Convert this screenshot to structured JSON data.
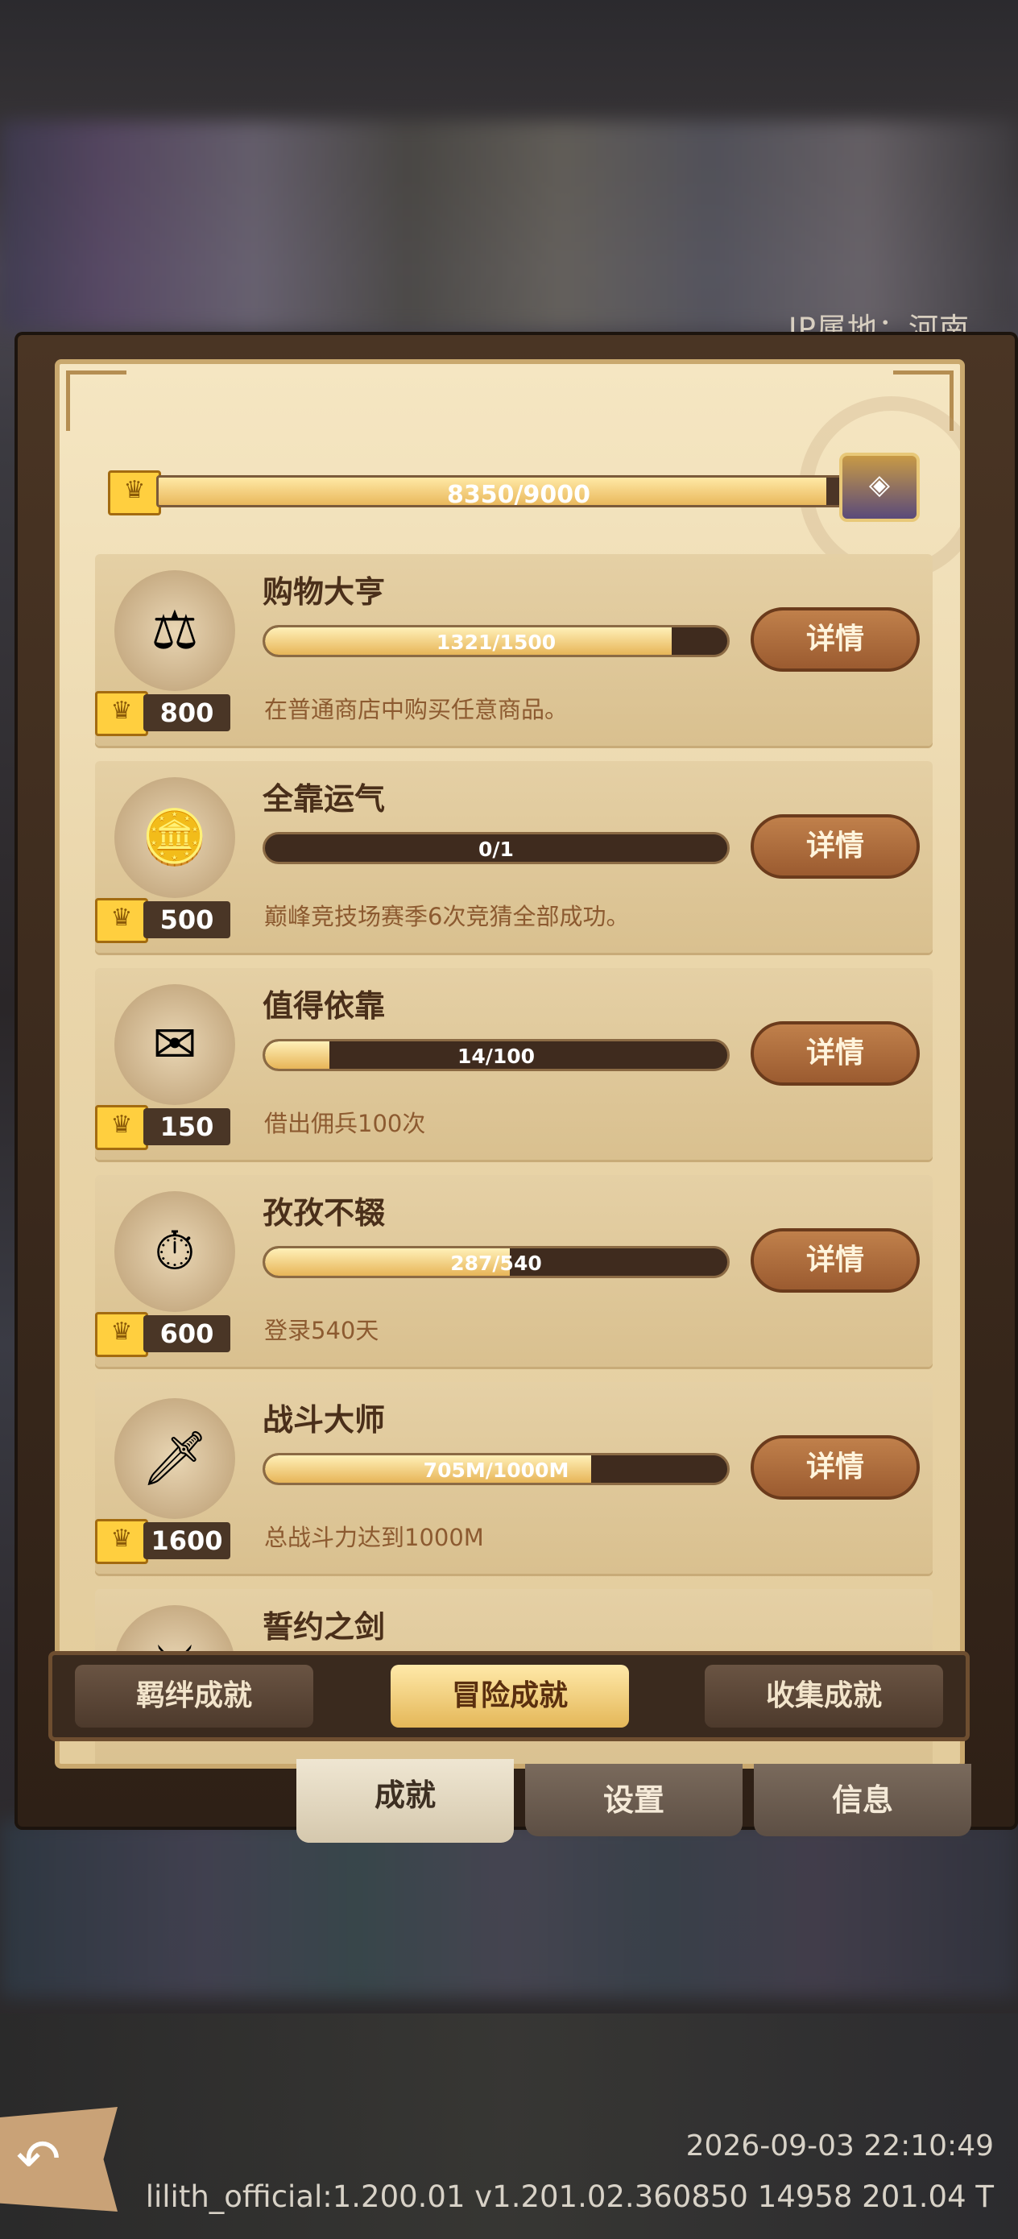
{
  "ip_location": "IP属地：河南",
  "total": {
    "current": 8350,
    "max": 9000,
    "text": "8350/9000",
    "crown_icon": "♛",
    "chest_icon": "◈"
  },
  "achievements": [
    {
      "title": "购物大亨",
      "progress_text": "1321/1500",
      "progress": 0.88,
      "points": "800",
      "description": "在普通商店中购买任意商品。",
      "button": "详情",
      "icon": "⚖"
    },
    {
      "title": "全靠运气",
      "progress_text": "0/1",
      "progress": 0.0,
      "points": "500",
      "description": "巅峰竞技场赛季6次竞猜全部成功。",
      "button": "详情",
      "icon": "🪙"
    },
    {
      "title": "值得依靠",
      "progress_text": "14/100",
      "progress": 0.14,
      "points": "150",
      "description": "借出佣兵100次",
      "button": "详情",
      "icon": "✉"
    },
    {
      "title": "孜孜不辍",
      "progress_text": "287/540",
      "progress": 0.53,
      "points": "600",
      "description": "登录540天",
      "button": "详情",
      "icon": "⏱"
    },
    {
      "title": "战斗大师",
      "progress_text": "705M/1000M",
      "progress": 0.705,
      "points": "1600",
      "description": "总战斗力达到1000M",
      "button": "详情",
      "icon": "🗡"
    },
    {
      "title": "誓约之剑",
      "progress_text": "",
      "progress": 0.0,
      "points": "",
      "description": "",
      "button": "",
      "icon": "⚔"
    }
  ],
  "sub_tabs": [
    "羁绊成就",
    "冒险成就",
    "收集成就"
  ],
  "main_tabs": [
    "成就",
    "设置",
    "信息"
  ],
  "back_icon": "↶",
  "datetime": "2026-09-03 22:10:49",
  "version": "lilith_official:1.200.01  v1.201.02.360850 14958 201.04 T"
}
